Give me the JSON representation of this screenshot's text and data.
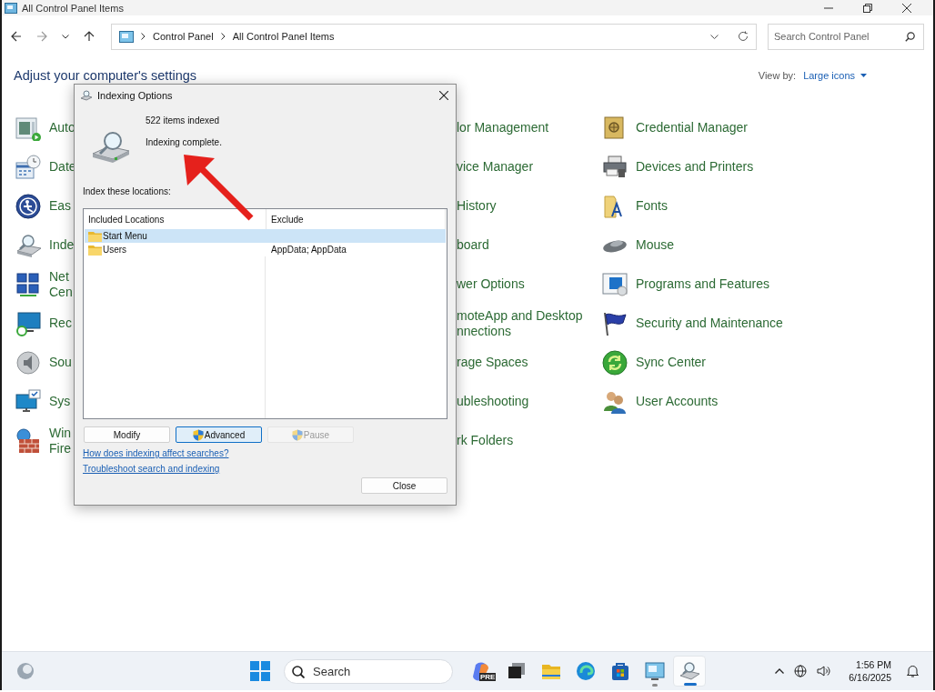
{
  "window": {
    "title": "All Control Panel Items"
  },
  "address_bar": {
    "segments": [
      "Control Panel",
      "All Control Panel Items"
    ]
  },
  "search": {
    "placeholder": "Search Control Panel"
  },
  "heading": "Adjust your computer's settings",
  "view_by": {
    "label": "View by:",
    "value": "Large icons"
  },
  "columns": [
    [
      {
        "label": "Auto"
      },
      {
        "label": "Date"
      },
      {
        "label": "Eas"
      },
      {
        "label": "Inde"
      },
      {
        "label": "Net\nCen"
      },
      {
        "label": "Rec"
      },
      {
        "label": "Sou"
      },
      {
        "label": "Sys"
      },
      {
        "label": "Win\nFire"
      }
    ],
    [
      {
        "label": "lor Management"
      },
      {
        "label": "vice Manager"
      },
      {
        "label": "History"
      },
      {
        "label": "board"
      },
      {
        "label": "wer Options"
      },
      {
        "label": "moteApp and Desktop\nnnections"
      },
      {
        "label": "rage Spaces"
      },
      {
        "label": "ubleshooting"
      },
      {
        "label": "rk Folders"
      }
    ],
    [
      {
        "label": "Credential Manager"
      },
      {
        "label": "Devices and Printers"
      },
      {
        "label": "Fonts"
      },
      {
        "label": "Mouse"
      },
      {
        "label": "Programs and Features"
      },
      {
        "label": "Security and Maintenance"
      },
      {
        "label": "Sync Center"
      },
      {
        "label": "User Accounts"
      }
    ]
  ],
  "dialog": {
    "title": "Indexing Options",
    "count": "522 items indexed",
    "status": "Indexing complete.",
    "locations_label": "Index these locations:",
    "table": {
      "columns": [
        "Included Locations",
        "Exclude"
      ],
      "rows": [
        {
          "location": "Start Menu",
          "exclude": "",
          "selected": true
        },
        {
          "location": "Users",
          "exclude": "AppData; AppData",
          "selected": false
        }
      ]
    },
    "buttons": [
      {
        "label": "Modify",
        "kind": "plain",
        "focused": false,
        "disabled": false
      },
      {
        "label": "Advanced",
        "kind": "admin",
        "focused": true,
        "disabled": false
      },
      {
        "label": "Pause",
        "kind": "admin",
        "focused": false,
        "disabled": true
      }
    ],
    "links": [
      "How does indexing affect searches?",
      "Troubleshoot search and indexing"
    ],
    "close_button": "Close"
  },
  "taskbar": {
    "search_placeholder": "Search",
    "badge": "PRE",
    "apps": [
      {
        "open": false,
        "selected": false
      },
      {
        "open": false,
        "selected": false
      },
      {
        "open": false,
        "selected": false
      },
      {
        "open": false,
        "selected": false
      },
      {
        "open": false,
        "selected": false
      },
      {
        "open": true,
        "selected": false
      },
      {
        "open": true,
        "selected": true
      }
    ],
    "time": "1:56 PM",
    "date": "6/16/2025"
  }
}
